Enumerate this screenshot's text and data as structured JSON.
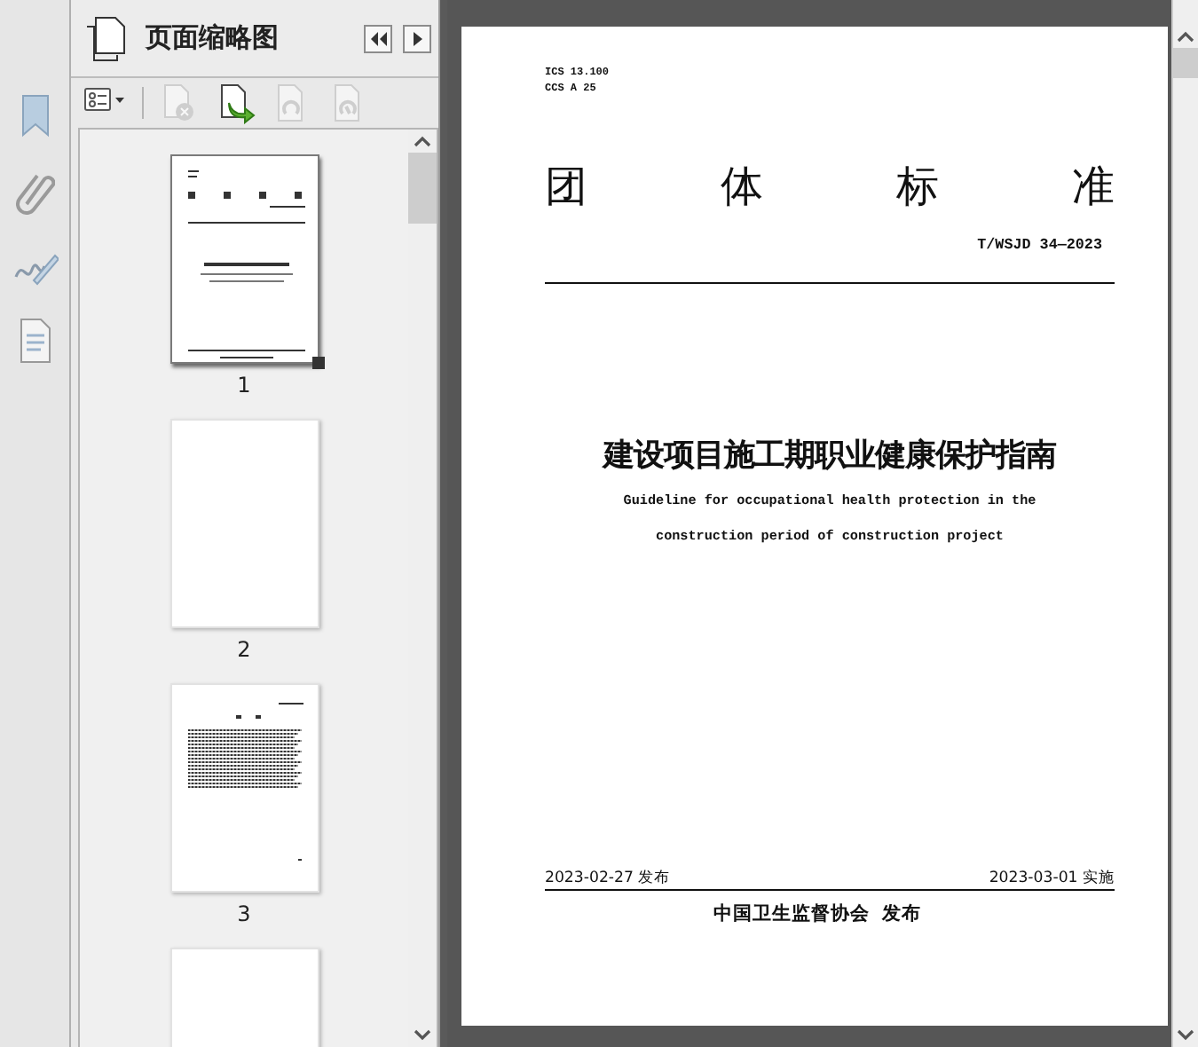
{
  "panel": {
    "title": "页面缩略图"
  },
  "toolbar": [
    {
      "kind": "options",
      "disabled": false
    },
    {
      "kind": "delete-page",
      "disabled": true
    },
    {
      "kind": "insert-page",
      "disabled": false
    },
    {
      "kind": "page-a",
      "disabled": true
    },
    {
      "kind": "page-b",
      "disabled": true
    }
  ],
  "thumbnails": [
    {
      "kind": "cover",
      "label": "1",
      "selected": true
    },
    {
      "kind": "blank",
      "label": "2",
      "selected": false
    },
    {
      "kind": "contents",
      "label": "3",
      "selected": false
    },
    {
      "kind": "blank",
      "selected": false
    }
  ],
  "document": {
    "codes": [
      "ICS 13.100",
      "CCS A 25"
    ],
    "heading": [
      "团",
      "体",
      "标",
      "准"
    ],
    "standard_number": "T/WSJD 34—2023",
    "title": "建设项目施工期职业健康保护指南",
    "subtitle": [
      "Guideline for occupational health protection in the",
      "construction period of construction project"
    ],
    "publish_date": "2023-02-27 发布",
    "effective_date": "2023-03-01 实施",
    "publisher": "中国卫生监督协会  发布"
  }
}
